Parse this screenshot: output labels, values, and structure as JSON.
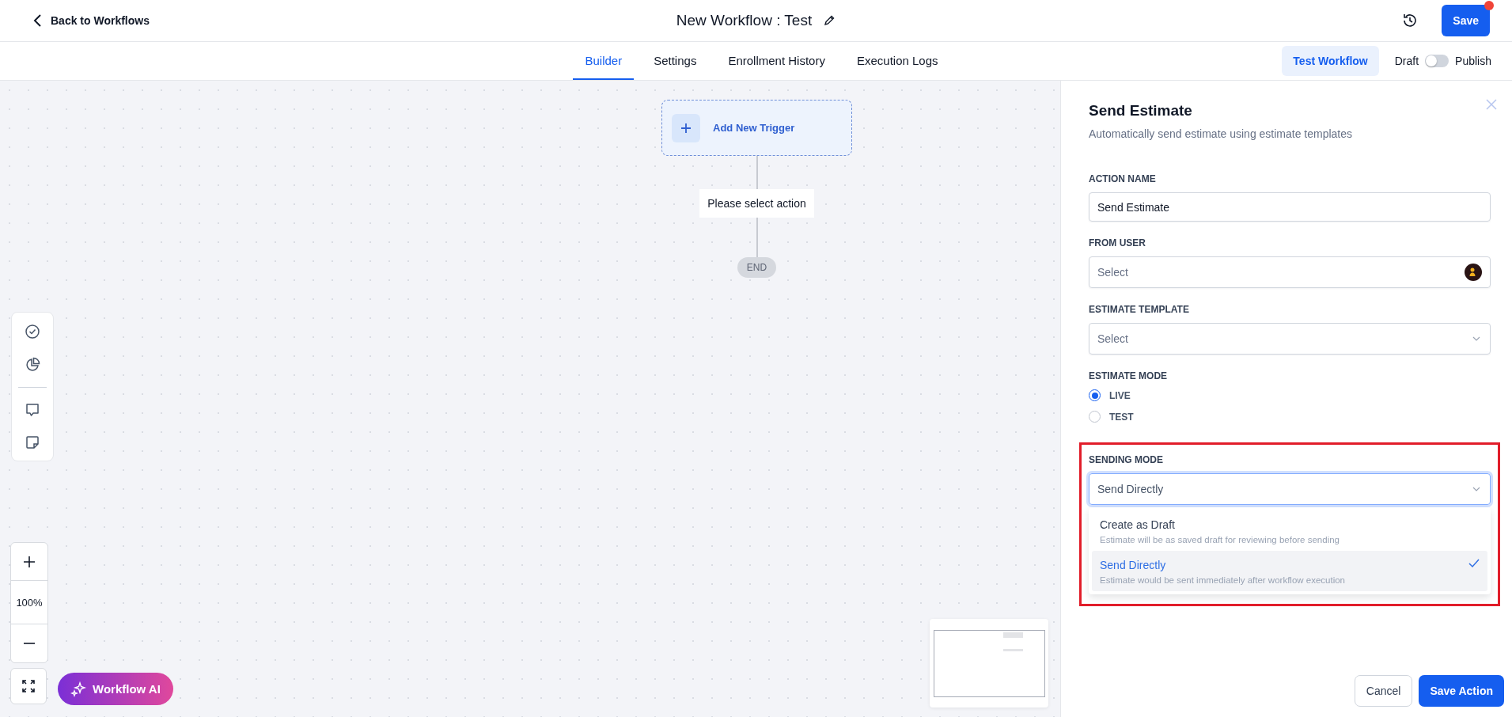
{
  "header": {
    "back_label": "Back to Workflows",
    "title": "New Workflow : Test",
    "save_label": "Save",
    "save_notification": true
  },
  "tabs": [
    {
      "label": "Builder",
      "selected": true
    },
    {
      "label": "Settings",
      "selected": false
    },
    {
      "label": "Enrollment History",
      "selected": false
    },
    {
      "label": "Execution Logs",
      "selected": false
    }
  ],
  "test_button": "Test Workflow",
  "publish_toggle": {
    "off_label": "Draft",
    "on_label": "Publish",
    "on": false
  },
  "canvas": {
    "trigger_label": "Add New Trigger",
    "action_placeholder": "Please select action",
    "end_label": "END",
    "zoom_level": "100%",
    "ai_button": "Workflow AI"
  },
  "panel": {
    "title": "Send Estimate",
    "subtitle": "Automatically send estimate using estimate templates",
    "fields": [
      {
        "kind": "text",
        "label": "ACTION NAME",
        "value": "Send Estimate",
        "highlighted": false
      },
      {
        "kind": "user-select",
        "label": "FROM USER",
        "placeholder": "Select",
        "highlighted": false
      },
      {
        "kind": "select",
        "label": "ESTIMATE TEMPLATE",
        "placeholder": "Select",
        "highlighted": false
      },
      {
        "kind": "radio",
        "label": "ESTIMATE MODE",
        "highlighted": false,
        "options": [
          {
            "label": "LIVE",
            "selected": true
          },
          {
            "label": "TEST",
            "selected": false
          }
        ]
      },
      {
        "kind": "dropdown",
        "label": "SENDING MODE",
        "value": "Send Directly",
        "expanded": true,
        "highlighted": true,
        "options": [
          {
            "label": "Create as Draft",
            "description": "Estimate will be as saved draft for reviewing before sending",
            "selected": false
          },
          {
            "label": "Send Directly",
            "description": "Estimate would be sent immediately after workflow execution",
            "selected": true
          }
        ]
      }
    ],
    "cancel_button": "Cancel",
    "save_button": "Save Action"
  }
}
